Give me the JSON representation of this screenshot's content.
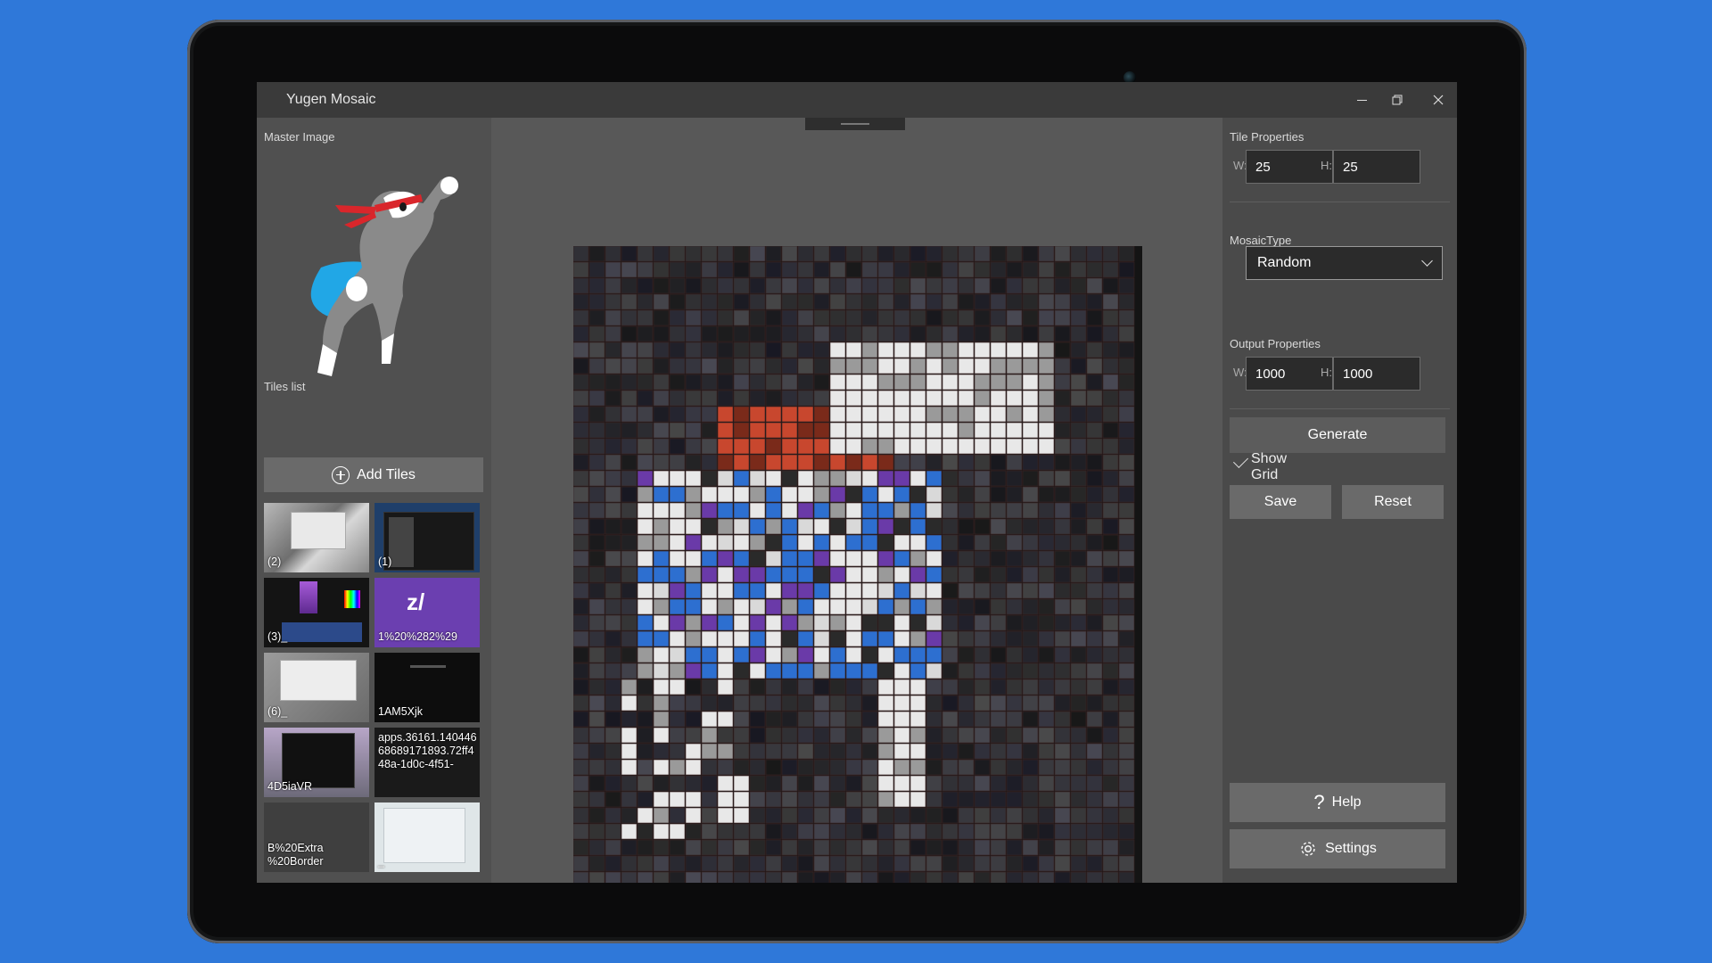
{
  "window": {
    "title": "Yugen Mosaic"
  },
  "left_pane": {
    "master_image_label": "Master Image",
    "tiles_list_label": "Tiles list",
    "add_tiles_label": "Add Tiles",
    "tiles": [
      {
        "label": "(2)"
      },
      {
        "label": "(1)"
      },
      {
        "label": "(3)_"
      },
      {
        "label": "1%20%282%29"
      },
      {
        "label": "(6)_"
      },
      {
        "label": "1AM5Xjk"
      },
      {
        "label": "4D5iaVR"
      },
      {
        "label": "apps.36161.140446\n68689171893.72ff4\n48a-1d0c-4f51-"
      },
      {
        "label": "B%20Extra\n%20Border"
      },
      {
        "label": "_"
      }
    ]
  },
  "right_pane": {
    "tile_properties_label": "Tile Properties",
    "tile_w_label": "W:",
    "tile_w": "25",
    "tile_h_label": "H:",
    "tile_h": "25",
    "mosaic_type_label": "MosaicType",
    "mosaic_type": "Random",
    "output_properties_label": "Output Properties",
    "out_w_label": "W:",
    "out_w": "1000",
    "out_h_label": "H:",
    "out_h": "1000",
    "generate_label": "Generate",
    "show_grid_label": "Show Grid",
    "show_grid_checked": true,
    "save_label": "Save",
    "reset_label": "Reset",
    "help_label": "Help",
    "settings_label": "Settings"
  },
  "colors": {
    "desktop": "#2f78d9",
    "pane_left": "#505050",
    "pane_center": "#585858",
    "pane_right": "#4a4a4a"
  }
}
